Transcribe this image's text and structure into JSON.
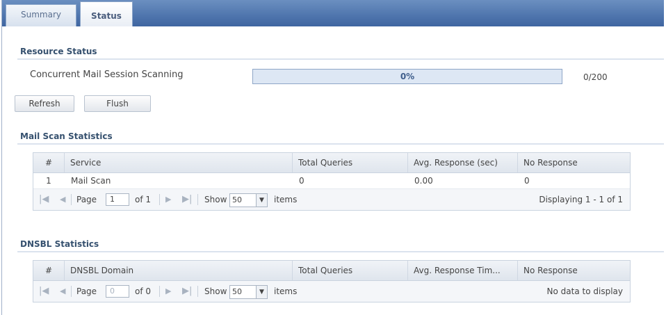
{
  "tabs": [
    {
      "label": "Summary"
    },
    {
      "label": "Status"
    }
  ],
  "resource_status": {
    "title": "Resource Status",
    "row_label": "Concurrent Mail Session Scanning",
    "progress_fraction": 0,
    "progress_text": "0%",
    "count_text": "0/200",
    "refresh_label": "Refresh",
    "flush_label": "Flush"
  },
  "mail_scan": {
    "title": "Mail Scan Statistics",
    "columns": [
      "#",
      "Service",
      "Total Queries",
      "Avg. Response (sec)",
      "No Response"
    ],
    "rows": [
      [
        "1",
        "Mail Scan",
        "0",
        "0.00",
        "0"
      ]
    ],
    "pager": {
      "page_label": "Page",
      "page_value": "1",
      "of_text": "of 1",
      "show_label": "Show",
      "show_value": "50",
      "items_label": "items",
      "status": "Displaying 1 - 1 of 1"
    }
  },
  "dnsbl": {
    "title": "DNSBL Statistics",
    "columns": [
      "#",
      "DNSBL Domain",
      "Total Queries",
      "Avg. Response Tim...",
      "No Response"
    ],
    "rows": [],
    "pager": {
      "page_label": "Page",
      "page_value": "0",
      "of_text": "of 0",
      "show_label": "Show",
      "show_value": "50",
      "items_label": "items",
      "status": "No data to display"
    }
  },
  "colors": {
    "tabbar": "#4f75ad",
    "section_title": "#36516f",
    "progress_bg": "#dde7f4"
  },
  "icons": {
    "first": "first-page-icon",
    "prev": "previous-page-icon",
    "next": "next-page-icon",
    "last": "last-page-icon",
    "dropdown": "chevron-down-icon"
  }
}
